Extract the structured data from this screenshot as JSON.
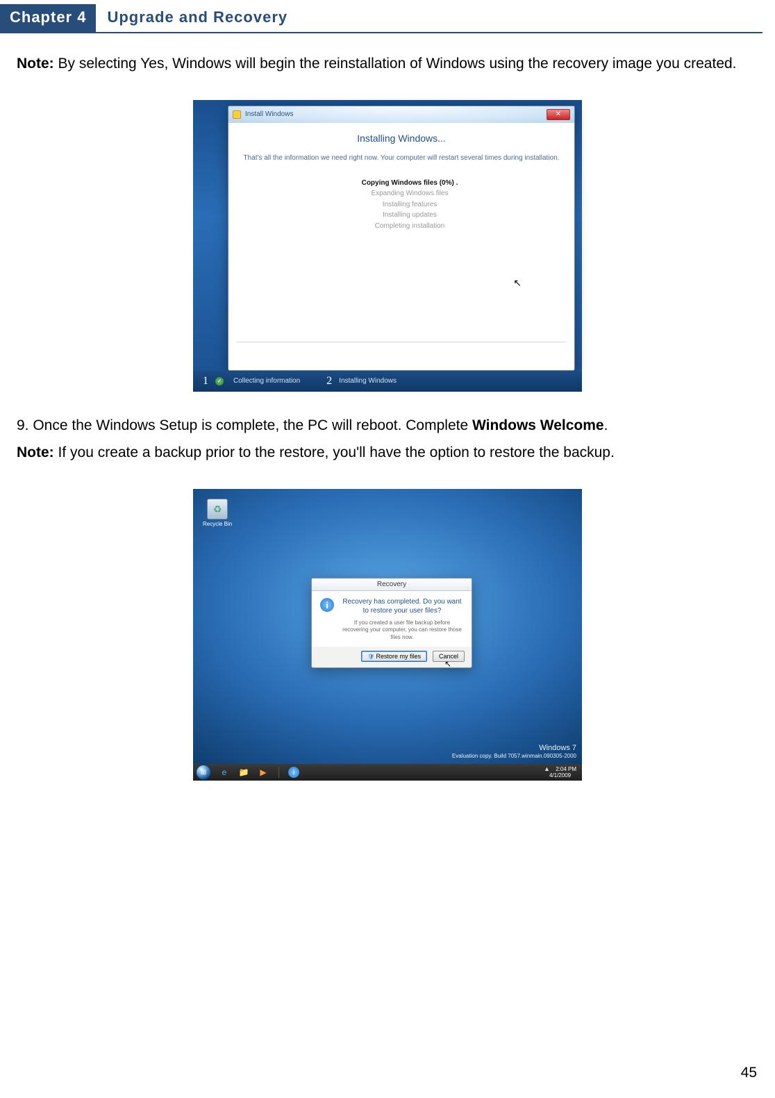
{
  "header": {
    "chapter_badge": "Chapter 4",
    "chapter_title": "Upgrade and Recovery"
  },
  "intro": {
    "note_label": "Note:",
    "note_text": " By selecting Yes, Windows will begin the reinstallation of Windows using the recovery image you created."
  },
  "figure1": {
    "window_title": "Install Windows",
    "close_glyph": "✕",
    "heading": "Installing Windows...",
    "info_text": "That's all the information we need right now. Your computer will restart several times during installation.",
    "steps": {
      "active": "Copying Windows files (0%) .",
      "s2": "Expanding Windows files",
      "s3": "Installing features",
      "s4": "Installing updates",
      "s5": "Completing installation"
    },
    "cursor_glyph": "↖",
    "footer": {
      "num1": "1",
      "label1": "Collecting information",
      "check_glyph": "✓",
      "num2": "2",
      "label2": "Installing Windows"
    }
  },
  "mid": {
    "step_text_a": "9. Once the Windows Setup is complete, the PC will reboot. Complete ",
    "step_bold": "Windows Welcome",
    "step_text_b": ".",
    "note_label": "Note:",
    "note_text": " If you create a backup prior to the restore, you'll have the option to restore the backup."
  },
  "figure2": {
    "recycle_label": "Recycle Bin",
    "dialog": {
      "title": "Recovery",
      "info_glyph": "i",
      "main_text": "Recovery has completed. Do you want to restore your user files?",
      "sub_text": "If you created a user file backup before recovering your computer, you can restore those files now.",
      "btn_primary_shield": "🛡",
      "btn_primary": "Restore my files",
      "btn_cancel": "Cancel"
    },
    "cursor_glyph": "↖",
    "watermark": {
      "title": "Windows 7",
      "sub": "Evaluation copy. Build 7057.winmain.090305-2000"
    },
    "taskbar": {
      "orb_glyph": "⊞",
      "ie_glyph": "e",
      "folder_glyph": "📁",
      "media_glyph": "▶",
      "info_glyph": "i",
      "tray_glyph": "▲",
      "time": "2:04 PM",
      "date": "4/1/2009"
    }
  },
  "page_number": "45"
}
